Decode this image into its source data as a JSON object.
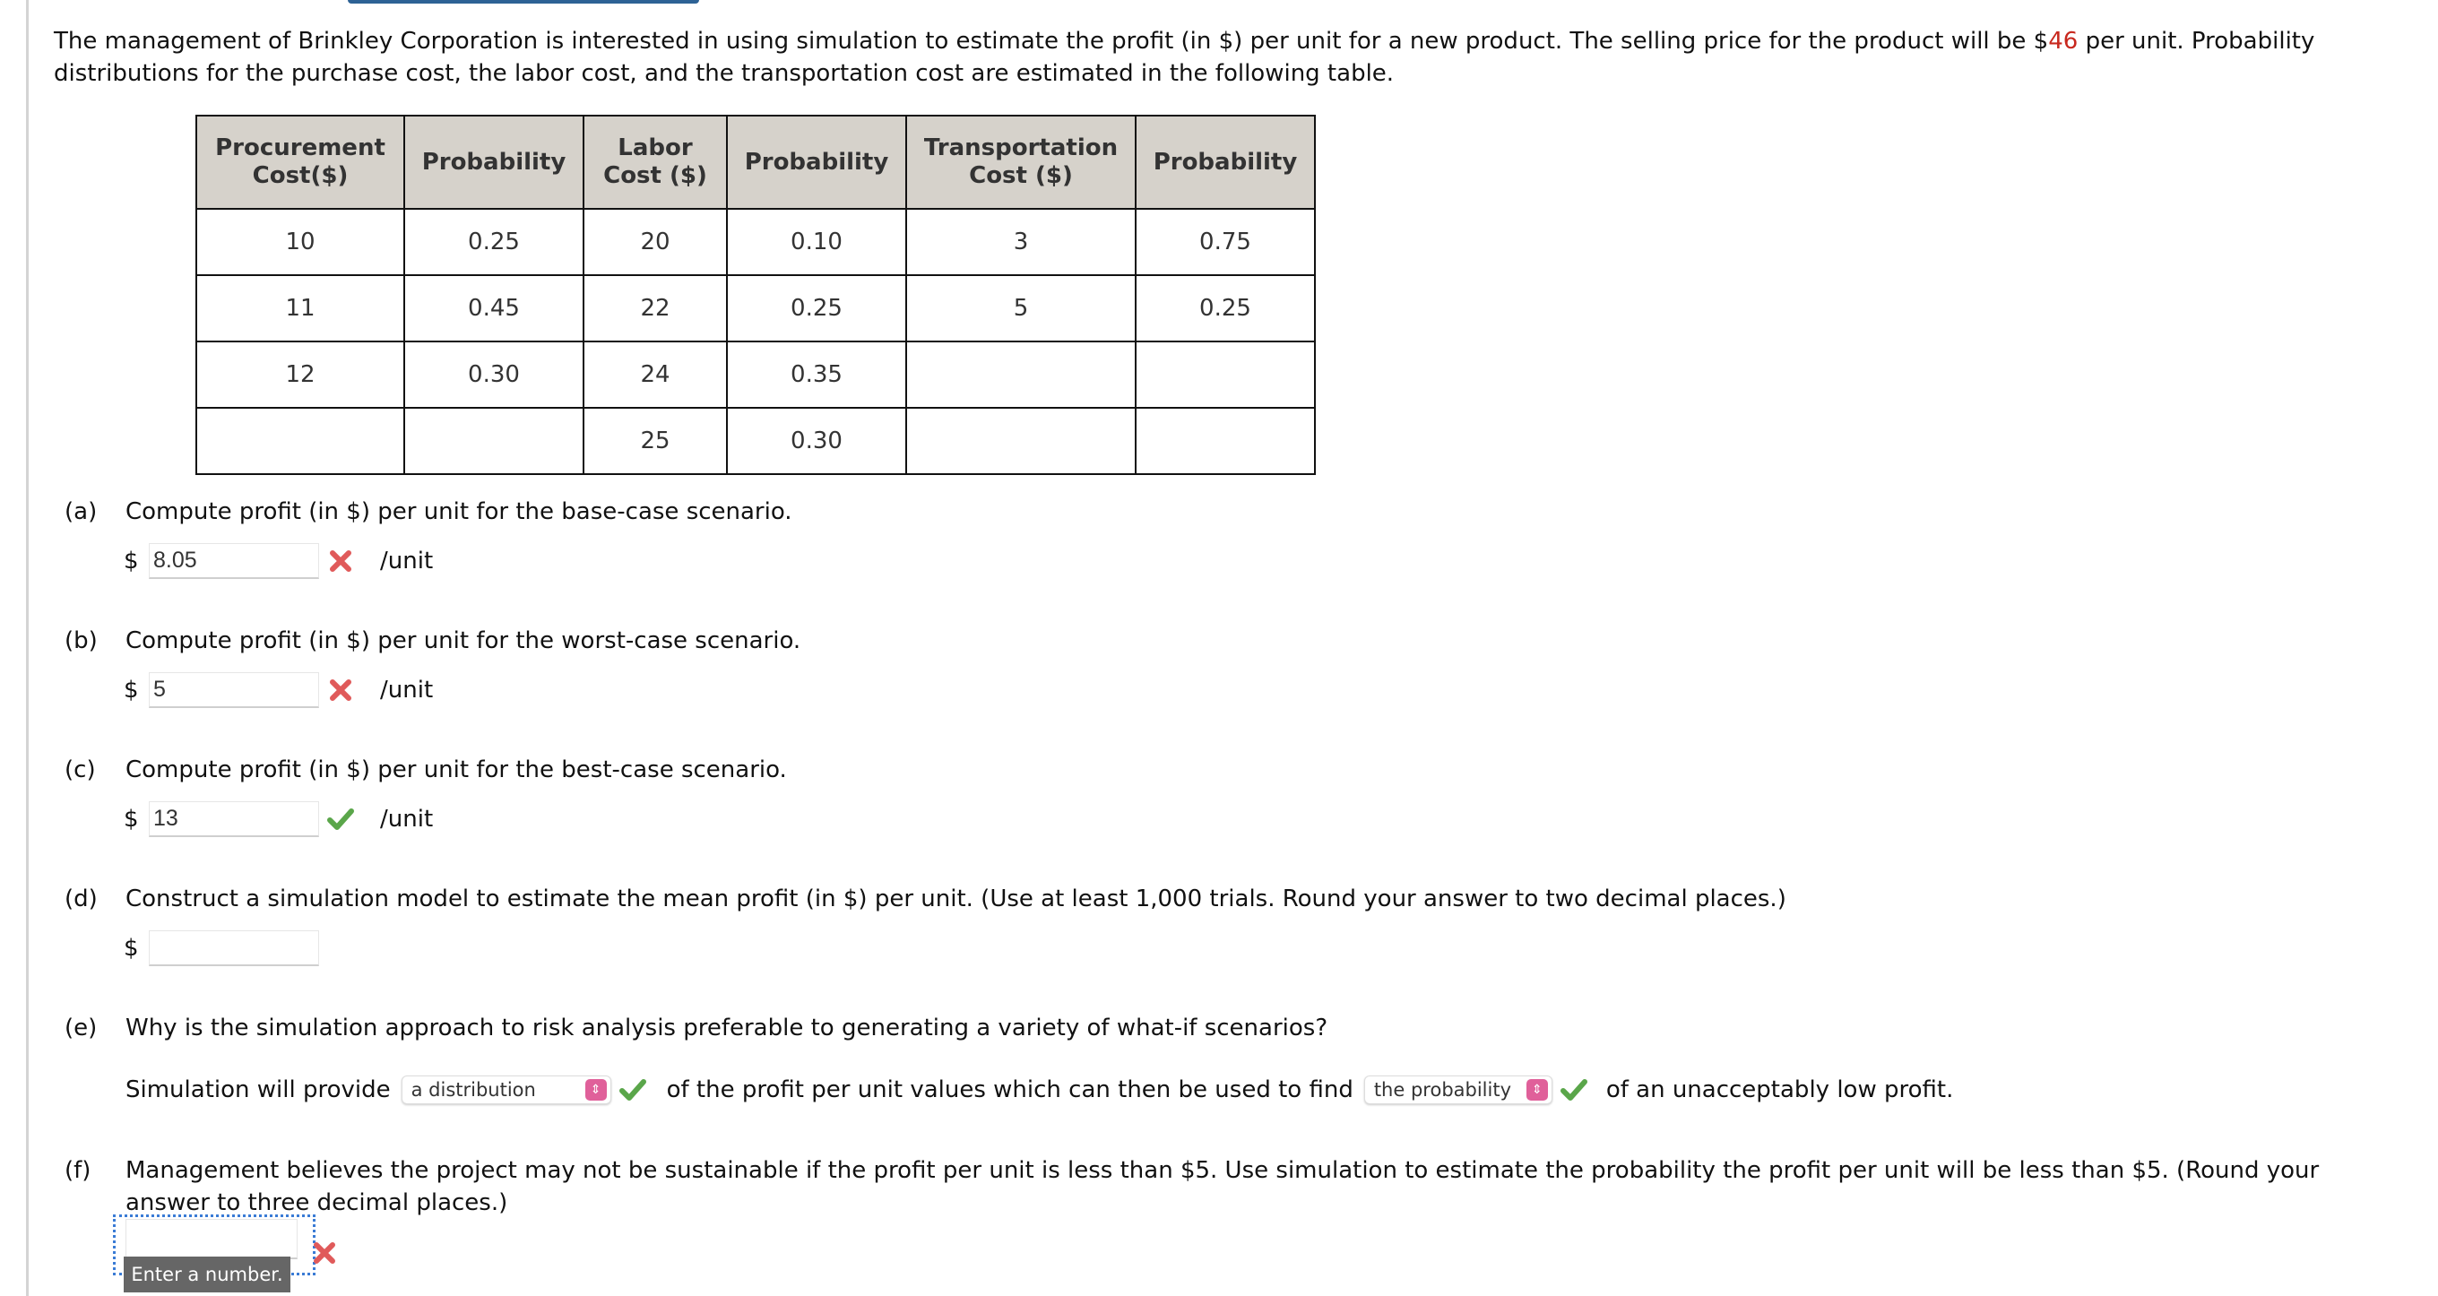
{
  "intro": {
    "text_before_price": "The management of Brinkley Corporation is interested in using simulation to estimate the profit (in $) per unit for a new product. The selling price for the product will be $",
    "price": "46",
    "text_after_price": " per unit. Probability distributions for the purchase cost, the labor cost, and the transportation cost are estimated in the following table."
  },
  "table": {
    "headers": [
      "Procurement\nCost($)",
      "Probability",
      "Labor\nCost ($)",
      "Probability",
      "Transportation\nCost ($)",
      "Probability"
    ],
    "rows": [
      [
        "10",
        "0.25",
        "20",
        "0.10",
        "3",
        "0.75"
      ],
      [
        "11",
        "0.45",
        "22",
        "0.25",
        "5",
        "0.25"
      ],
      [
        "12",
        "0.30",
        "24",
        "0.35",
        "",
        ""
      ],
      [
        "",
        "",
        "25",
        "0.30",
        "",
        ""
      ]
    ]
  },
  "questions": {
    "a": {
      "label": "(a)",
      "text": "Compute profit (in $) per unit for the base-case scenario.",
      "currency": "$",
      "value": "8.05",
      "status": "incorrect",
      "unit": "/unit"
    },
    "b": {
      "label": "(b)",
      "text": "Compute profit (in $) per unit for the worst-case scenario.",
      "currency": "$",
      "value": "5",
      "status": "incorrect",
      "unit": "/unit"
    },
    "c": {
      "label": "(c)",
      "text": "Compute profit (in $) per unit for the best-case scenario.",
      "currency": "$",
      "value": "13",
      "status": "correct",
      "unit": "/unit"
    },
    "d": {
      "label": "(d)",
      "text": "Construct a simulation model to estimate the mean profit (in $) per unit. (Use at least 1,000 trials. Round your answer to two decimal places.)",
      "currency": "$",
      "value": ""
    },
    "e": {
      "label": "(e)",
      "text": "Why is the simulation approach to risk analysis preferable to generating a variety of what-if scenarios?",
      "sentence_part1": "Simulation will provide",
      "select1": "a distribution",
      "sentence_part2": "of the profit per unit values which can then be used to find",
      "select2": "the probability",
      "sentence_part3": "of an unacceptably low profit.",
      "select1_status": "correct",
      "select2_status": "correct"
    },
    "f": {
      "label": "(f)",
      "text_line1": "Management believes the project may not be sustainable if the profit per unit is less than $5. Use simulation to estimate the probability the profit per unit will be less than $5. (Round your",
      "text_line2": "answer to three decimal places.)",
      "value": "",
      "status": "incorrect",
      "tooltip": "Enter a number."
    }
  },
  "colors": {
    "accent_red": "#c8281e",
    "correct_green": "#5aa64a",
    "incorrect_red": "#e05a5a",
    "select_pink": "#e0609a",
    "focus_blue": "#3a7bd5",
    "table_header_bg": "#d6d2cb"
  }
}
